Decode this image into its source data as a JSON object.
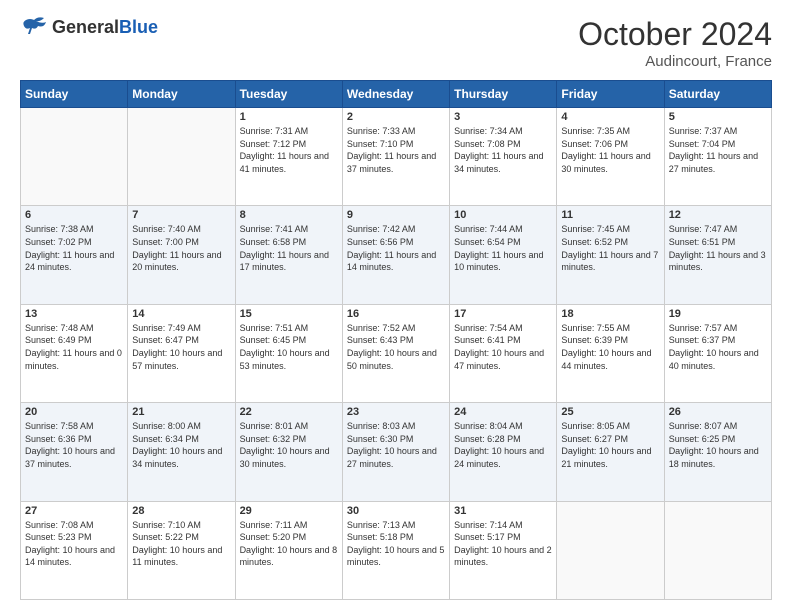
{
  "header": {
    "logo_general": "General",
    "logo_blue": "Blue",
    "month_title": "October 2024",
    "subtitle": "Audincourt, France"
  },
  "weekdays": [
    "Sunday",
    "Monday",
    "Tuesday",
    "Wednesday",
    "Thursday",
    "Friday",
    "Saturday"
  ],
  "weeks": [
    [
      {
        "day": "",
        "info": ""
      },
      {
        "day": "",
        "info": ""
      },
      {
        "day": "1",
        "info": "Sunrise: 7:31 AM\nSunset: 7:12 PM\nDaylight: 11 hours and 41 minutes."
      },
      {
        "day": "2",
        "info": "Sunrise: 7:33 AM\nSunset: 7:10 PM\nDaylight: 11 hours and 37 minutes."
      },
      {
        "day": "3",
        "info": "Sunrise: 7:34 AM\nSunset: 7:08 PM\nDaylight: 11 hours and 34 minutes."
      },
      {
        "day": "4",
        "info": "Sunrise: 7:35 AM\nSunset: 7:06 PM\nDaylight: 11 hours and 30 minutes."
      },
      {
        "day": "5",
        "info": "Sunrise: 7:37 AM\nSunset: 7:04 PM\nDaylight: 11 hours and 27 minutes."
      }
    ],
    [
      {
        "day": "6",
        "info": "Sunrise: 7:38 AM\nSunset: 7:02 PM\nDaylight: 11 hours and 24 minutes."
      },
      {
        "day": "7",
        "info": "Sunrise: 7:40 AM\nSunset: 7:00 PM\nDaylight: 11 hours and 20 minutes."
      },
      {
        "day": "8",
        "info": "Sunrise: 7:41 AM\nSunset: 6:58 PM\nDaylight: 11 hours and 17 minutes."
      },
      {
        "day": "9",
        "info": "Sunrise: 7:42 AM\nSunset: 6:56 PM\nDaylight: 11 hours and 14 minutes."
      },
      {
        "day": "10",
        "info": "Sunrise: 7:44 AM\nSunset: 6:54 PM\nDaylight: 11 hours and 10 minutes."
      },
      {
        "day": "11",
        "info": "Sunrise: 7:45 AM\nSunset: 6:52 PM\nDaylight: 11 hours and 7 minutes."
      },
      {
        "day": "12",
        "info": "Sunrise: 7:47 AM\nSunset: 6:51 PM\nDaylight: 11 hours and 3 minutes."
      }
    ],
    [
      {
        "day": "13",
        "info": "Sunrise: 7:48 AM\nSunset: 6:49 PM\nDaylight: 11 hours and 0 minutes."
      },
      {
        "day": "14",
        "info": "Sunrise: 7:49 AM\nSunset: 6:47 PM\nDaylight: 10 hours and 57 minutes."
      },
      {
        "day": "15",
        "info": "Sunrise: 7:51 AM\nSunset: 6:45 PM\nDaylight: 10 hours and 53 minutes."
      },
      {
        "day": "16",
        "info": "Sunrise: 7:52 AM\nSunset: 6:43 PM\nDaylight: 10 hours and 50 minutes."
      },
      {
        "day": "17",
        "info": "Sunrise: 7:54 AM\nSunset: 6:41 PM\nDaylight: 10 hours and 47 minutes."
      },
      {
        "day": "18",
        "info": "Sunrise: 7:55 AM\nSunset: 6:39 PM\nDaylight: 10 hours and 44 minutes."
      },
      {
        "day": "19",
        "info": "Sunrise: 7:57 AM\nSunset: 6:37 PM\nDaylight: 10 hours and 40 minutes."
      }
    ],
    [
      {
        "day": "20",
        "info": "Sunrise: 7:58 AM\nSunset: 6:36 PM\nDaylight: 10 hours and 37 minutes."
      },
      {
        "day": "21",
        "info": "Sunrise: 8:00 AM\nSunset: 6:34 PM\nDaylight: 10 hours and 34 minutes."
      },
      {
        "day": "22",
        "info": "Sunrise: 8:01 AM\nSunset: 6:32 PM\nDaylight: 10 hours and 30 minutes."
      },
      {
        "day": "23",
        "info": "Sunrise: 8:03 AM\nSunset: 6:30 PM\nDaylight: 10 hours and 27 minutes."
      },
      {
        "day": "24",
        "info": "Sunrise: 8:04 AM\nSunset: 6:28 PM\nDaylight: 10 hours and 24 minutes."
      },
      {
        "day": "25",
        "info": "Sunrise: 8:05 AM\nSunset: 6:27 PM\nDaylight: 10 hours and 21 minutes."
      },
      {
        "day": "26",
        "info": "Sunrise: 8:07 AM\nSunset: 6:25 PM\nDaylight: 10 hours and 18 minutes."
      }
    ],
    [
      {
        "day": "27",
        "info": "Sunrise: 7:08 AM\nSunset: 5:23 PM\nDaylight: 10 hours and 14 minutes."
      },
      {
        "day": "28",
        "info": "Sunrise: 7:10 AM\nSunset: 5:22 PM\nDaylight: 10 hours and 11 minutes."
      },
      {
        "day": "29",
        "info": "Sunrise: 7:11 AM\nSunset: 5:20 PM\nDaylight: 10 hours and 8 minutes."
      },
      {
        "day": "30",
        "info": "Sunrise: 7:13 AM\nSunset: 5:18 PM\nDaylight: 10 hours and 5 minutes."
      },
      {
        "day": "31",
        "info": "Sunrise: 7:14 AM\nSunset: 5:17 PM\nDaylight: 10 hours and 2 minutes."
      },
      {
        "day": "",
        "info": ""
      },
      {
        "day": "",
        "info": ""
      }
    ]
  ]
}
